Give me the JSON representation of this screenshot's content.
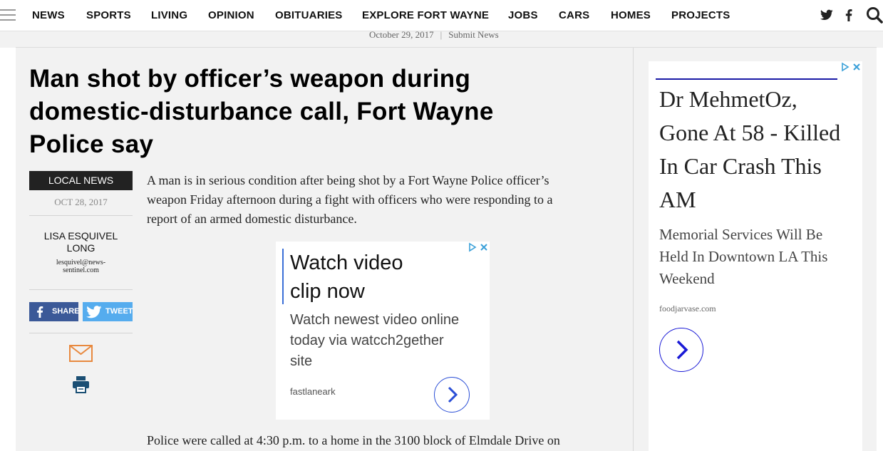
{
  "nav": {
    "items": [
      "NEWS",
      "SPORTS",
      "LIVING",
      "OPINION",
      "OBITUARIES",
      "EXPLORE FORT WAYNE",
      "JOBS",
      "CARS",
      "HOMES",
      "PROJECTS"
    ]
  },
  "subbar": {
    "date": "October 29, 2017",
    "sep": "|",
    "submit": "Submit News"
  },
  "article": {
    "headline_lines": [
      "Man shot by officer’s weapon during",
      "domestic-disturbance call, Fort Wayne",
      "Police say"
    ],
    "category": "LOCAL NEWS",
    "date": "OCT 28, 2017",
    "author_lines": [
      "LISA ESQUIVEL",
      "LONG"
    ],
    "email_lines": [
      "lesquivel@news-",
      "sentinel.com"
    ],
    "share_fb": "SHARE",
    "share_tw": "TWEET",
    "lede_lines": [
      "A man is in serious condition after being shot by a Fort Wayne Police officer’s",
      "weapon Friday afternoon during a fight with officers who were responding to a",
      "report of an armed domestic disturbance."
    ],
    "para2": "Police were called at 4:30 p.m. to a home in the 3100 block of Elmdale Drive on"
  },
  "ad_inline": {
    "title_lines": [
      "Watch video",
      "clip now"
    ],
    "body_lines": [
      "Watch newest video online",
      "today via watcch2gether",
      "site"
    ],
    "source": "fastlaneark"
  },
  "ad_side": {
    "title_lines": [
      "Dr MehmetOz,",
      "Gone At 58 - Killed",
      "In Car Crash This",
      "AM"
    ],
    "body_lines": [
      "Memorial Services Will Be",
      "Held In Downtown LA This",
      "Weekend"
    ],
    "source": "foodjarvase.com"
  },
  "colors": {
    "facebook": "#3b5998",
    "twitter": "#55acee",
    "ad_accent": "#2b4fd6",
    "category_bg": "#222222",
    "email_icon": "#e8893f",
    "print_icon": "#1b4f74"
  }
}
